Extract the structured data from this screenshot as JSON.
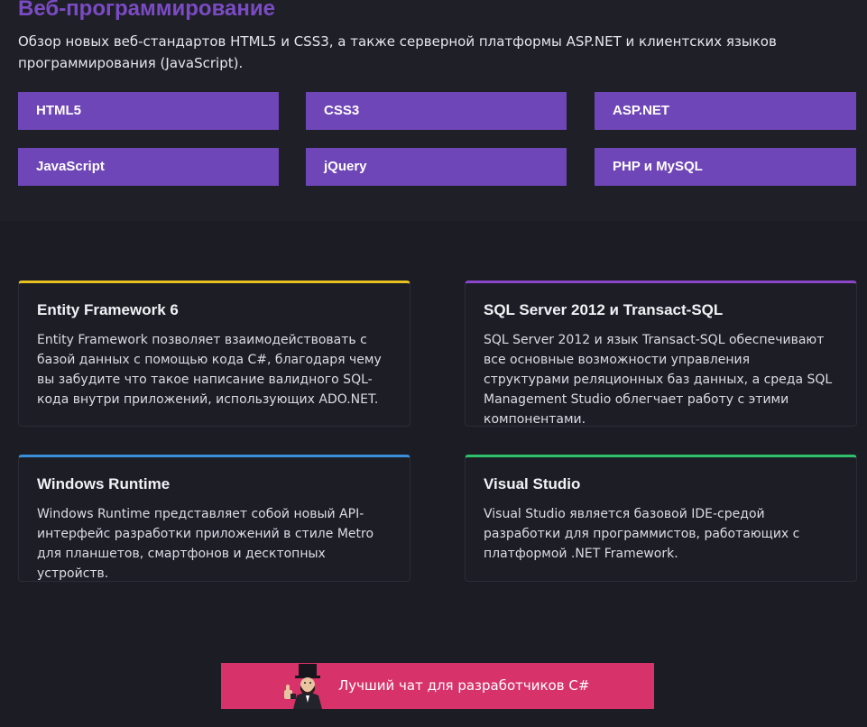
{
  "web": {
    "title": "Веб-программирование",
    "description": "Обзор новых веб-стандартов HTML5 и CSS3, а также серверной платформы ASP.NET и клиентских языков программирования (JavaScript).",
    "tags": [
      "HTML5",
      "CSS3",
      "ASP.NET",
      "JavaScript",
      "jQuery",
      "PHP и MySQL"
    ]
  },
  "cards": [
    {
      "title": "Entity Framework 6",
      "text": "Entity Framework позволяет взаимодействовать с базой данных с помощью кода C#, благодаря чему вы забудите что такое написание валидного SQL-кода внутри приложений, использующих ADO.NET.",
      "accent": "#e8c020"
    },
    {
      "title": "SQL Server 2012 и Transact-SQL",
      "text": "SQL Server 2012 и язык Transact-SQL обеспечивают все основные возможности управления структурами реляционных баз данных, а среда SQL Management Studio облегчает работу с этими компонентами.",
      "accent": "#8a45c8"
    },
    {
      "title": "Windows Runtime",
      "text": "Windows Runtime представляет собой новый API-интерфейс разработки приложений в стиле Metro для планшетов, смартфонов и десктопных устройств.",
      "accent": "#3a8fd8"
    },
    {
      "title": "Visual Studio",
      "text": "Visual Studio является базовой IDE-средой разработки для программистов, работающих с платформой .NET Framework.",
      "accent": "#2ec06a"
    }
  ],
  "banner": {
    "text": "Лучший чат для разработчиков C#",
    "icon": "lincoln-thumbs-up-avatar",
    "color": "#d8326a"
  },
  "colors": {
    "background": "#1f1f28",
    "title": "#7b4bc4",
    "tag": "#6f46b7"
  }
}
